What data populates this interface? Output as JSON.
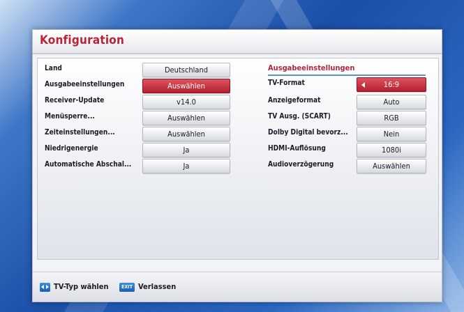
{
  "window": {
    "title": "Konfiguration"
  },
  "left_settings": [
    {
      "label": "Land",
      "value": "Deutschland",
      "selected": false
    },
    {
      "label": "Ausgabeeinstellungen",
      "value": "Auswählen",
      "selected": true
    },
    {
      "label": "Receiver-Update",
      "value": "v14.0",
      "selected": false
    },
    {
      "label": "Menüsperre...",
      "value": "Auswählen",
      "selected": false
    },
    {
      "label": "Zeiteinstellungen...",
      "value": "Auswählen",
      "selected": false
    },
    {
      "label": "Niedrigenergie",
      "value": "Ja",
      "selected": false
    },
    {
      "label": "Automatische Abschal...",
      "value": "Ja",
      "selected": false
    }
  ],
  "right_section": {
    "title": "Ausgabeeinstellungen",
    "items": [
      {
        "label": "TV-Format",
        "value": "16:9",
        "selected": true
      },
      {
        "label": "Anzeigeformat",
        "value": "Auto",
        "selected": false
      },
      {
        "label": "TV Ausg. (SCART)",
        "value": "RGB",
        "selected": false
      },
      {
        "label": "Dolby Digital bevorz...",
        "value": "Nein",
        "selected": false
      },
      {
        "label": "HDMI-Auflösung",
        "value": "1080i",
        "selected": false
      },
      {
        "label": "Audioverzögerung",
        "value": "Auswählen",
        "selected": false
      }
    ]
  },
  "footer": {
    "tv_type_key": "left-right-arrows-icon",
    "tv_type_label": "TV-Typ wählen",
    "exit_key": "EXIT",
    "exit_label": "Verlassen"
  },
  "colors": {
    "accent_red": "#b8253a",
    "selection_red": "#b31f2e",
    "section_line_blue": "#5b93cf",
    "background_blue": "#1b4fa8"
  }
}
